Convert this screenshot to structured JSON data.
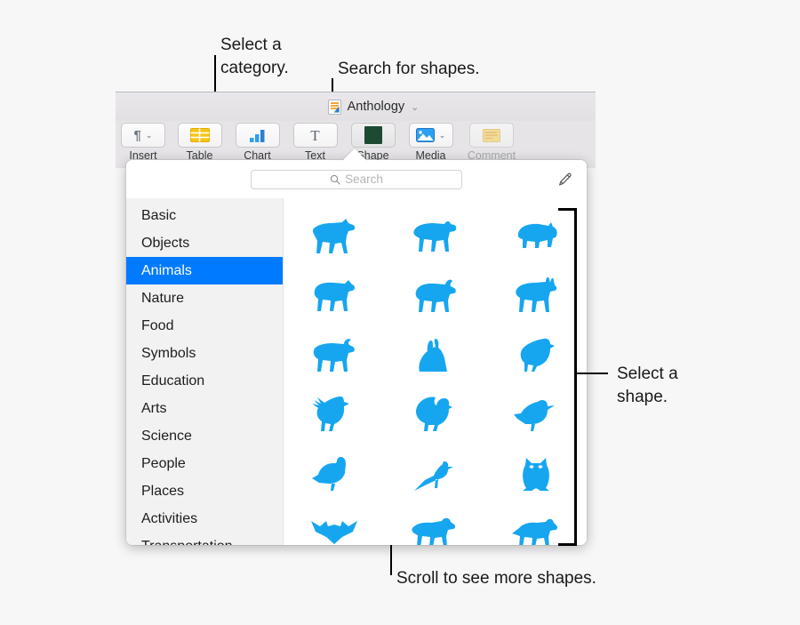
{
  "annotations": {
    "category": "Select a\ncategory.",
    "search": "Search for shapes.",
    "shape": "Select a\nshape.",
    "scroll": "Scroll to see more shapes."
  },
  "window": {
    "document_title": "Anthology",
    "title_chevron": "⌄",
    "doc_icon": "pages-document-icon"
  },
  "toolbar": {
    "items": [
      {
        "label": "Insert",
        "icon": "paragraph-insert-icon",
        "glyph": "¶",
        "has_chevron": true,
        "dimmed": false
      },
      {
        "label": "Table",
        "icon": "table-icon",
        "glyph": "",
        "has_chevron": false,
        "dimmed": false
      },
      {
        "label": "Chart",
        "icon": "bar-chart-icon",
        "glyph": "",
        "has_chevron": false,
        "dimmed": false
      },
      {
        "label": "Text",
        "icon": "text-icon",
        "glyph": "T",
        "has_chevron": false,
        "dimmed": false
      },
      {
        "label": "Shape",
        "icon": "shape-icon",
        "glyph": "",
        "has_chevron": false,
        "dimmed": false
      },
      {
        "label": "Media",
        "icon": "media-icon",
        "glyph": "",
        "has_chevron": true,
        "dimmed": false
      },
      {
        "label": "Comment",
        "icon": "comment-icon",
        "glyph": "",
        "has_chevron": false,
        "dimmed": true
      }
    ]
  },
  "popover": {
    "search": {
      "placeholder": "Search",
      "value": "",
      "icon": "search-icon"
    },
    "pen_icon": "pen-draw-icon",
    "categories": [
      {
        "label": "Basic",
        "selected": false
      },
      {
        "label": "Objects",
        "selected": false
      },
      {
        "label": "Animals",
        "selected": true
      },
      {
        "label": "Nature",
        "selected": false
      },
      {
        "label": "Food",
        "selected": false
      },
      {
        "label": "Symbols",
        "selected": false
      },
      {
        "label": "Education",
        "selected": false
      },
      {
        "label": "Arts",
        "selected": false
      },
      {
        "label": "Science",
        "selected": false
      },
      {
        "label": "People",
        "selected": false
      },
      {
        "label": "Places",
        "selected": false
      },
      {
        "label": "Activities",
        "selected": false
      },
      {
        "label": "Transportation",
        "selected": false
      }
    ],
    "shape_color": "#16a6f0",
    "selection_color": "#007aff",
    "shapes": [
      {
        "name": "horse"
      },
      {
        "name": "cow"
      },
      {
        "name": "pig"
      },
      {
        "name": "sheep"
      },
      {
        "name": "goat"
      },
      {
        "name": "donkey"
      },
      {
        "name": "bull"
      },
      {
        "name": "rabbit"
      },
      {
        "name": "hen"
      },
      {
        "name": "rooster"
      },
      {
        "name": "turkey"
      },
      {
        "name": "duck"
      },
      {
        "name": "goose"
      },
      {
        "name": "bird"
      },
      {
        "name": "owl"
      },
      {
        "name": "bat"
      },
      {
        "name": "dog"
      },
      {
        "name": "dog-2"
      }
    ]
  }
}
